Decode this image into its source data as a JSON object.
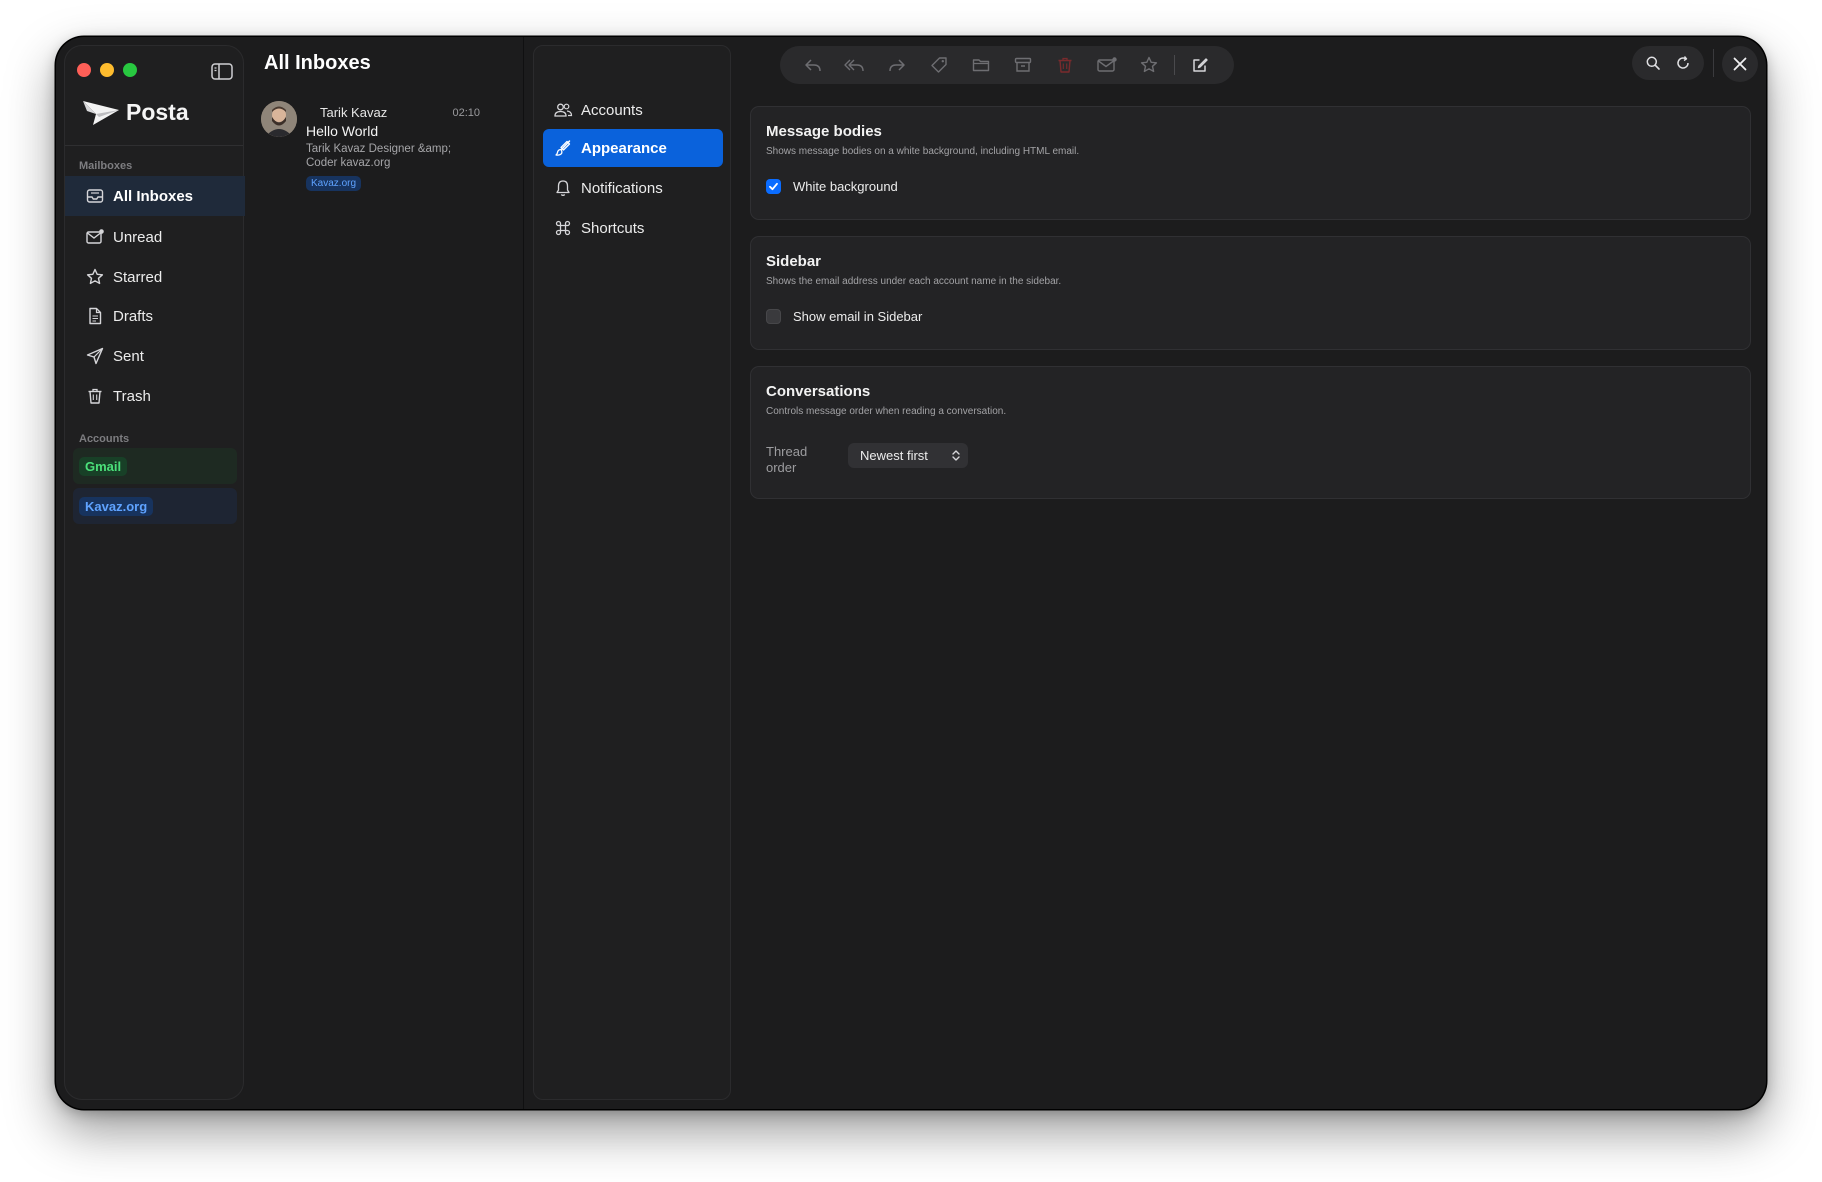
{
  "app": {
    "name": "Posta"
  },
  "sidebar": {
    "mailboxes_label": "Mailboxes",
    "mailboxes": [
      {
        "id": "all-inboxes",
        "label": "All Inboxes",
        "icon": "inbox-icon",
        "active": true
      },
      {
        "id": "unread",
        "label": "Unread",
        "icon": "envelope-badge-icon",
        "active": false
      },
      {
        "id": "starred",
        "label": "Starred",
        "icon": "star-icon",
        "active": false
      },
      {
        "id": "drafts",
        "label": "Drafts",
        "icon": "document-icon",
        "active": false
      },
      {
        "id": "sent",
        "label": "Sent",
        "icon": "paper-plane-icon",
        "active": false
      },
      {
        "id": "trash",
        "label": "Trash",
        "icon": "trash-icon",
        "active": false
      }
    ],
    "accounts_label": "Accounts",
    "accounts": [
      {
        "label": "Gmail",
        "color": "#4be07a"
      },
      {
        "label": "Kavaz.org",
        "color": "#5fa3ff"
      }
    ]
  },
  "message_list": {
    "title": "All Inboxes",
    "messages": [
      {
        "sender": "Tarik Kavaz",
        "time": "02:10",
        "subject": "Hello World",
        "preview": "Tarik Kavaz Designer &amp; Coder kavaz.org",
        "account_badge": "Kavaz.org"
      }
    ]
  },
  "settings": {
    "nav": [
      {
        "label": "Accounts",
        "icon": "people-icon",
        "active": false
      },
      {
        "label": "Appearance",
        "icon": "paintbrush-icon",
        "active": true
      },
      {
        "label": "Notifications",
        "icon": "bell-icon",
        "active": false
      },
      {
        "label": "Shortcuts",
        "icon": "command-icon",
        "active": false
      }
    ],
    "message_bodies": {
      "title": "Message bodies",
      "description": "Shows message bodies on a white background, including HTML email.",
      "option_label": "White background",
      "checked": true
    },
    "sidebar": {
      "title": "Sidebar",
      "description": "Shows the email address under each account name in the sidebar.",
      "option_label": "Show email in Sidebar",
      "checked": false
    },
    "conversations": {
      "title": "Conversations",
      "description": "Controls message order when reading a conversation.",
      "thread_order_label": "Thread order",
      "thread_order_value": "Newest first"
    }
  },
  "toolbar": {
    "buttons": [
      "reply-icon",
      "reply-all-icon",
      "forward-icon",
      "tag-icon",
      "folder-icon",
      "archive-icon",
      "trash-icon",
      "envelope-badge-icon",
      "star-icon",
      "compose-icon"
    ],
    "accent_delete": "#e5484d"
  },
  "colors": {
    "accent": "#0a62dc",
    "window_bg": "#1c1c1d"
  }
}
